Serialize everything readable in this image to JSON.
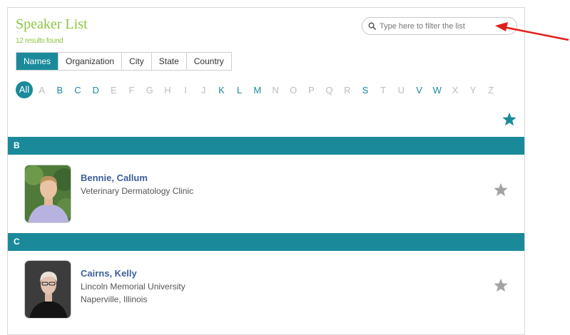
{
  "header": {
    "title": "Speaker List",
    "results": "12 results found"
  },
  "search": {
    "placeholder": "Type here to filter the list"
  },
  "tabs": [
    {
      "label": "Names",
      "active": true
    },
    {
      "label": "Organization",
      "active": false
    },
    {
      "label": "City",
      "active": false
    },
    {
      "label": "State",
      "active": false
    },
    {
      "label": "Country",
      "active": false
    }
  ],
  "alphabet": {
    "all_label": "All",
    "letters": [
      "A",
      "B",
      "C",
      "D",
      "E",
      "F",
      "G",
      "H",
      "I",
      "J",
      "K",
      "L",
      "M",
      "N",
      "O",
      "P",
      "Q",
      "R",
      "S",
      "T",
      "U",
      "V",
      "W",
      "X",
      "Y",
      "Z"
    ],
    "active_letters": [
      "B",
      "C",
      "D",
      "K",
      "L",
      "M",
      "S",
      "V",
      "W"
    ]
  },
  "sections": [
    {
      "letter": "B",
      "speakers": [
        {
          "name": "Bennie, Callum",
          "organization": "Veterinary Dermatology Clinic",
          "location": ""
        }
      ]
    },
    {
      "letter": "C",
      "speakers": [
        {
          "name": "Cairns, Kelly",
          "organization": "Lincoln Memorial University",
          "location": "Naperville, Illinois"
        }
      ]
    }
  ],
  "colors": {
    "accent": "#1a8a9b",
    "title_green": "#8cc63f",
    "name_blue": "#3d5f9e",
    "star_gray": "#a3a3a3",
    "annotation_red": "#e0201b"
  },
  "icons": {
    "search": "magnifier-icon",
    "favorite": "star-icon",
    "annotation": "red-arrow"
  }
}
